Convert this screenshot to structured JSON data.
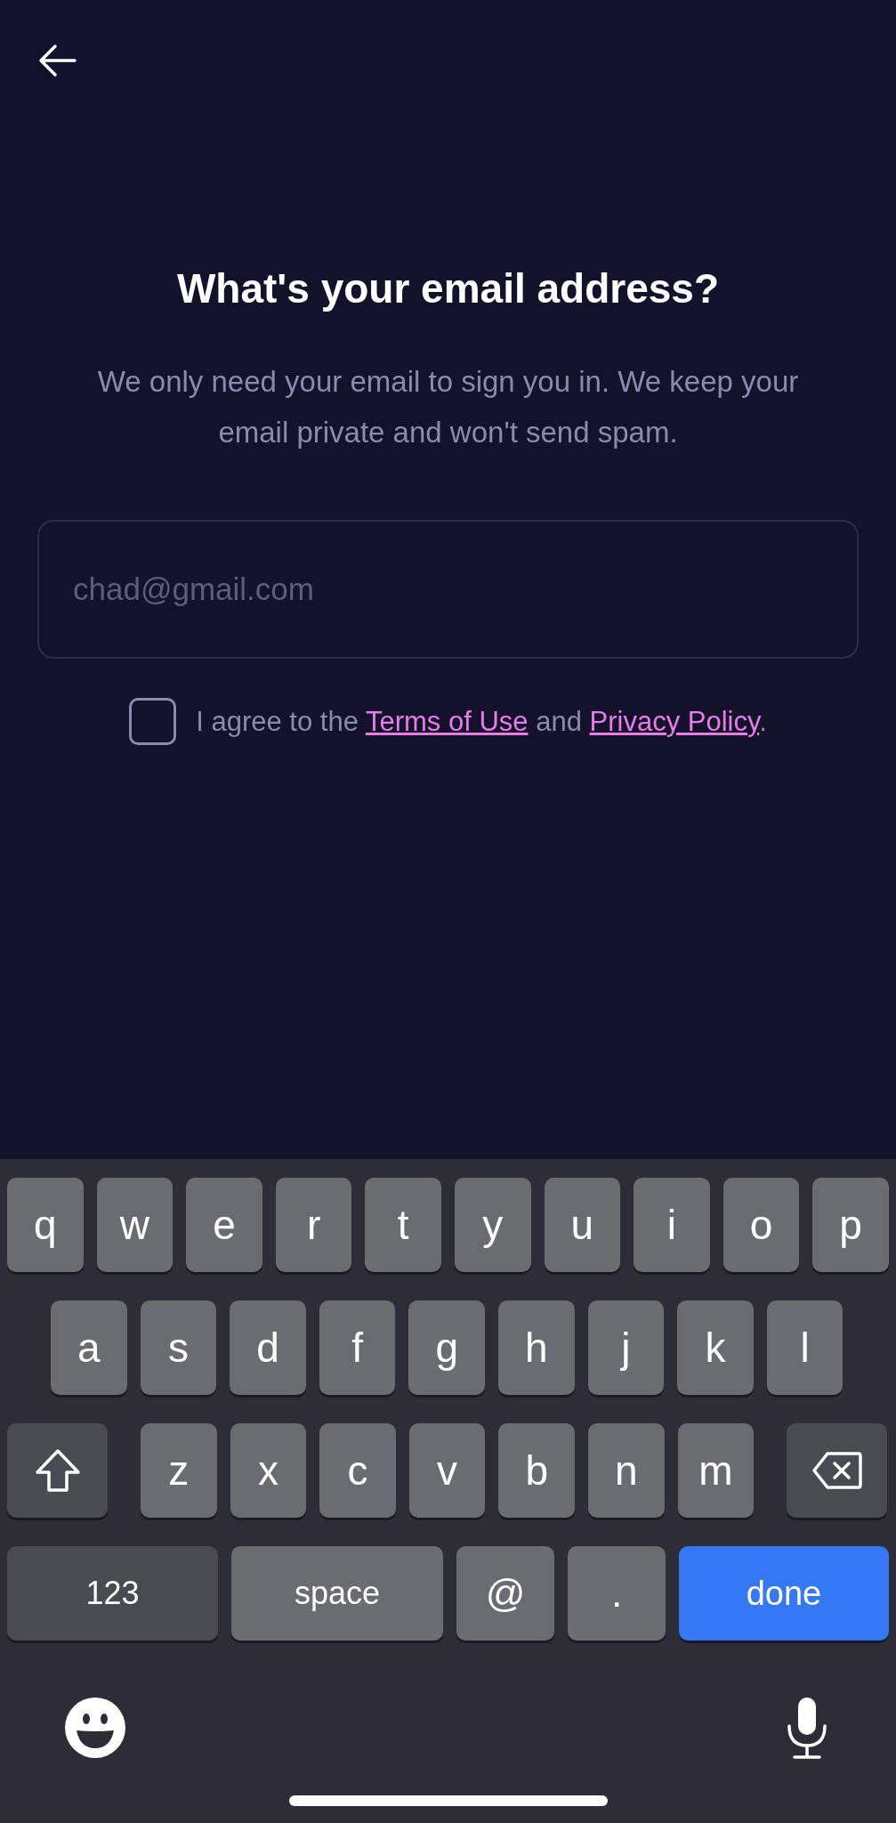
{
  "title": "What's your email address?",
  "subtitle": "We only need your email to sign you in. We keep your email private and won't send spam.",
  "email_field": {
    "placeholder": "chad@gmail.com"
  },
  "agreement": {
    "checked": false,
    "parts": [
      {
        "kind": "text",
        "text": "I agree to the "
      },
      {
        "kind": "link",
        "text": "Terms of Use"
      },
      {
        "kind": "text",
        "text": " and "
      },
      {
        "kind": "link",
        "text": "Privacy Policy"
      },
      {
        "kind": "text",
        "text": "."
      }
    ]
  },
  "keyboard": {
    "letter_rows": [
      {
        "keys": [
          {
            "kind": "letter",
            "label": "q"
          },
          {
            "kind": "letter",
            "label": "w"
          },
          {
            "kind": "letter",
            "label": "e"
          },
          {
            "kind": "letter",
            "label": "r"
          },
          {
            "kind": "letter",
            "label": "t"
          },
          {
            "kind": "letter",
            "label": "y"
          },
          {
            "kind": "letter",
            "label": "u"
          },
          {
            "kind": "letter",
            "label": "i"
          },
          {
            "kind": "letter",
            "label": "o"
          },
          {
            "kind": "letter",
            "label": "p"
          }
        ]
      },
      {
        "keys": [
          {
            "kind": "letter",
            "label": "a"
          },
          {
            "kind": "letter",
            "label": "s"
          },
          {
            "kind": "letter",
            "label": "d"
          },
          {
            "kind": "letter",
            "label": "f"
          },
          {
            "kind": "letter",
            "label": "g"
          },
          {
            "kind": "letter",
            "label": "h"
          },
          {
            "kind": "letter",
            "label": "j"
          },
          {
            "kind": "letter",
            "label": "k"
          },
          {
            "kind": "letter",
            "label": "l"
          }
        ]
      },
      {
        "keys": [
          {
            "kind": "shift"
          },
          {
            "kind": "letter",
            "label": "z"
          },
          {
            "kind": "letter",
            "label": "x"
          },
          {
            "kind": "letter",
            "label": "c"
          },
          {
            "kind": "letter",
            "label": "v"
          },
          {
            "kind": "letter",
            "label": "b"
          },
          {
            "kind": "letter",
            "label": "n"
          },
          {
            "kind": "letter",
            "label": "m"
          },
          {
            "kind": "delete"
          }
        ]
      }
    ],
    "function_keys": [
      {
        "kind": "mode",
        "label": "123"
      },
      {
        "kind": "space",
        "label": "space"
      },
      {
        "kind": "symbol",
        "label": "@"
      },
      {
        "kind": "symbol",
        "label": "."
      },
      {
        "kind": "return",
        "label": "done"
      }
    ]
  }
}
